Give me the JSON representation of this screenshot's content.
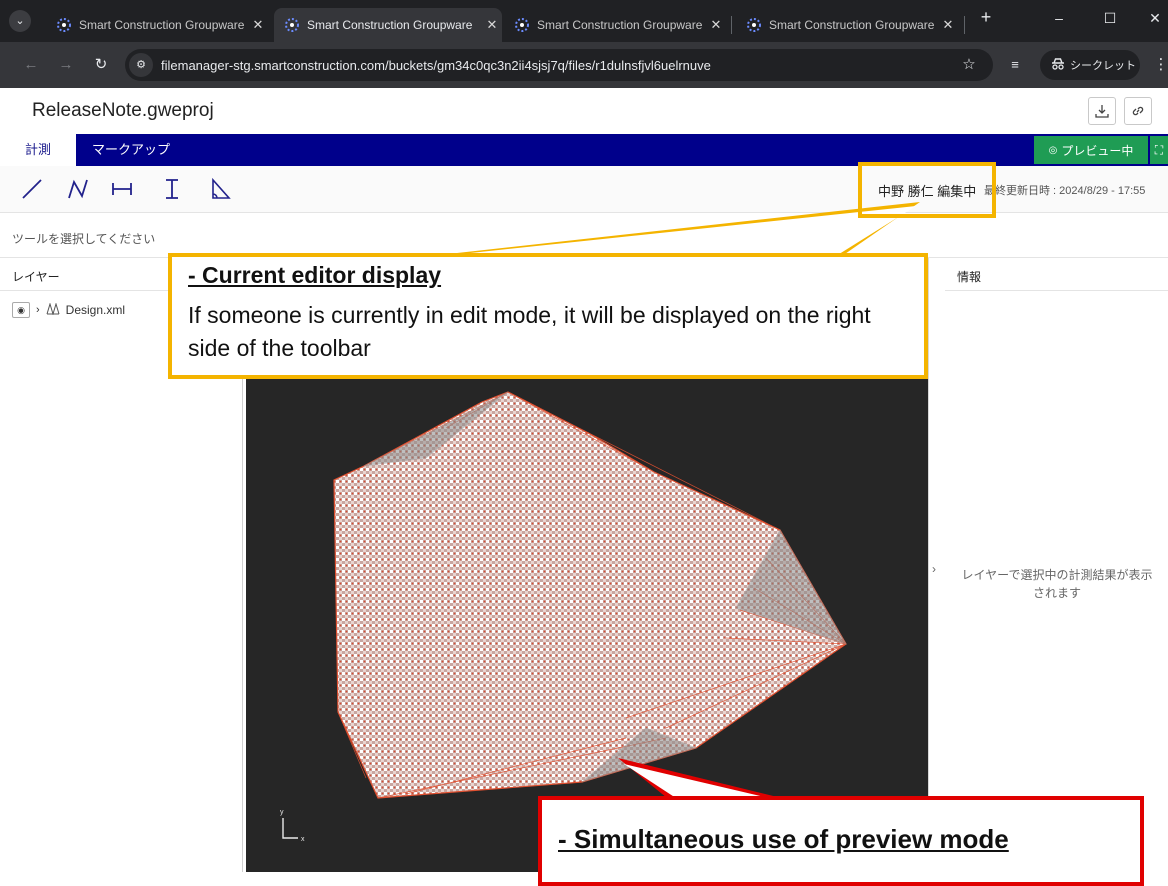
{
  "browser": {
    "tabs": [
      {
        "title": "Smart Construction Groupware",
        "active": false
      },
      {
        "title": "Smart Construction Groupware",
        "active": true
      },
      {
        "title": "Smart Construction Groupware",
        "active": false
      },
      {
        "title": "Smart Construction Groupware",
        "active": false
      }
    ],
    "url": "filemanager-stg.smartconstruction.com/buckets/gm34c0qc3n2ii4sjsj7q/files/r1dulnsfjvl6uelrnuve",
    "incognito_label": "シークレット"
  },
  "app": {
    "file_name": "ReleaseNote.gweproj",
    "tabs": [
      "計測",
      "マークアップ"
    ],
    "active_tab": "計測",
    "preview_label": "プレビュー中",
    "editor_status": "中野 勝仁 編集中",
    "last_updated": "最終更新日時 : 2024/8/29 - 17:55",
    "tool_hint": "ツールを選択してください",
    "layers_title": "レイヤー",
    "layer_item": "Design.xml",
    "info_title": "情報",
    "info_message": "レイヤーで選択中の計測結果が表示されます",
    "axis_x": "x",
    "axis_y": "y"
  },
  "annotations": {
    "editor_callout_title": "- Current editor display",
    "editor_callout_body": "If someone is currently in edit mode, it will be displayed on the right side of the toolbar",
    "preview_callout_title": "- Simultaneous use of preview mode"
  },
  "colors": {
    "tab_bar_blue": "#00008b",
    "preview_green": "#1f9c54",
    "callout_yellow": "#f4b400",
    "callout_red": "#e00000",
    "mesh_red": "#e05030"
  }
}
